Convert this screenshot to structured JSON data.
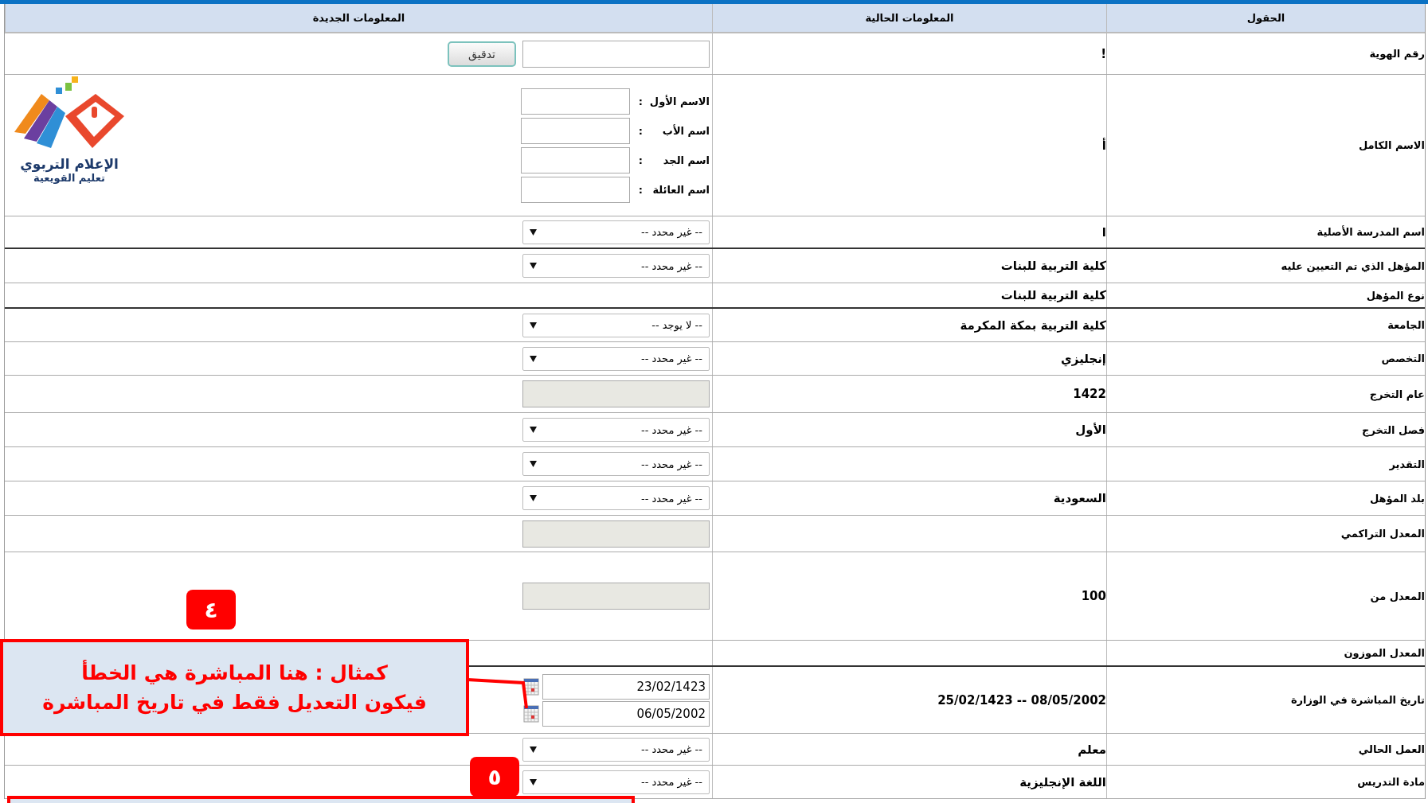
{
  "header": {
    "columns": [
      "الحقول",
      "المعلومات الحالية",
      "المعلومات الجديدة"
    ]
  },
  "logo": {
    "title": "الإعلام التربوي",
    "subtitle": "تعليم القويعية"
  },
  "rows": [
    {
      "kind": "id",
      "field": "رقم الهوية",
      "current": "!",
      "button": "تدقيق"
    },
    {
      "kind": "names",
      "field": "الاسم الكامل",
      "current": "أ",
      "names": [
        {
          "label": "الاسم الأول",
          "separator": ":"
        },
        {
          "label": "اسم الأب",
          "separator": ":"
        },
        {
          "label": "اسم الجد",
          "separator": ":"
        },
        {
          "label": "اسم العائلة",
          "separator": ":"
        }
      ]
    },
    {
      "kind": "select",
      "field": "اسم المدرسة الأصلية",
      "current": "ا",
      "value": "-- غير محدد --"
    },
    {
      "kind": "select",
      "field": "المؤهل الذي تم التعيين عليه",
      "current": "كلية التربية للبنات",
      "value": "-- غير محدد --"
    },
    {
      "kind": "empty",
      "field": "نوع المؤهل",
      "current": "كلية التربية للبنات"
    },
    {
      "kind": "select",
      "field": "الجامعة",
      "current": "كلية التربية بمكة المكرمة",
      "value": "-- لا يوجد --"
    },
    {
      "kind": "select",
      "field": "التخصص",
      "current": "إنجليزي",
      "value": "-- غير محدد --"
    },
    {
      "kind": "input",
      "field": "عام التخرج",
      "current": "1422",
      "disabled": true
    },
    {
      "kind": "select",
      "field": "فصل التخرج",
      "current": "الأول",
      "value": "-- غير محدد --"
    },
    {
      "kind": "select",
      "field": "التقدير",
      "value": "-- غير محدد --"
    },
    {
      "kind": "select",
      "field": "بلد المؤهل",
      "current": "السعودية",
      "value": "-- غير محدد --"
    },
    {
      "kind": "input",
      "field": "المعدل التراكمي",
      "disabled": true
    },
    {
      "kind": "input",
      "field": "المعدل من",
      "current": "100",
      "disabled": true
    },
    {
      "kind": "empty",
      "field": "المعدل الموزون"
    },
    {
      "kind": "dates",
      "field": "تاريخ المباشرة في الوزارة",
      "current": "08/05/2002 -- 25/02/1423",
      "dates": [
        "23/02/1423",
        "06/05/2002"
      ]
    },
    {
      "kind": "select",
      "field": "العمل الحالي",
      "current": "معلم",
      "value": "-- غير محدد --"
    },
    {
      "kind": "select",
      "field": "مادة التدريس",
      "current": "اللغة الإنجليزية",
      "value": "-- غير محدد --"
    }
  ],
  "annotations": {
    "badges": [
      "٤",
      "٥"
    ],
    "callout": {
      "lines": [
        "كمثال : هنا المباشرة هي الخطأ",
        "فيكون التعديل فقط في تاريخ المباشرة"
      ]
    }
  }
}
